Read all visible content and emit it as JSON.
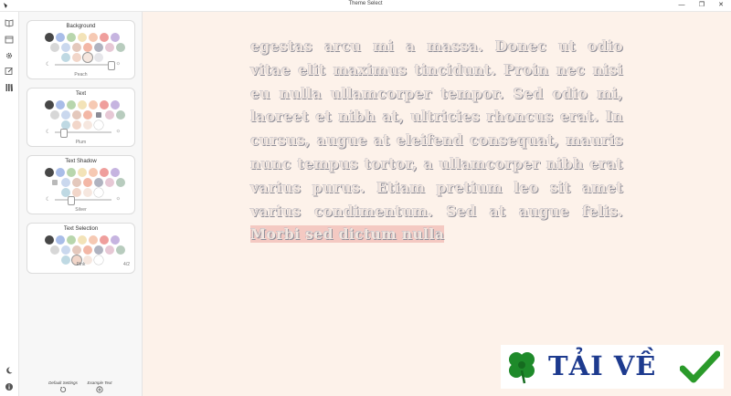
{
  "window": {
    "title": "Theme Select",
    "minimize_glyph": "—",
    "maximize_glyph": "❐",
    "close_glyph": "✕"
  },
  "rail": {
    "icons": [
      "book-icon",
      "calendar-icon",
      "gear-icon",
      "edit-icon",
      "library-icon"
    ],
    "bottom_icons": [
      "moon-icon",
      "info-icon"
    ]
  },
  "panel": {
    "cards": [
      {
        "title": "Background",
        "selected": "Peach",
        "slider_value": 0.85
      },
      {
        "title": "Text",
        "selected": "Plum",
        "slider_value": 0.12
      },
      {
        "title": "Text Shadow",
        "selected": "Silver",
        "slider_value": 0.25
      },
      {
        "title": "Text Selection",
        "selected": "Pink",
        "corner": "4/2"
      }
    ],
    "footer": {
      "default_settings": "Default Settings",
      "example_text": "Example Text"
    }
  },
  "reader": {
    "body": "egestas arcu mi a massa. Donec ut odio vitae elit maximus tincidunt. Proin nec nisi eu nulla ullamcorper tempor. Sed odio mi, laoreet et nibh at, ultricies rhoncus erat. In cursus, augue at eleifend consequat, mauris nunc tempus tortor, a ullamcorper nibh erat varius purus. Etiam pretium leo sit amet varius condimentum. Sed at augue felis.",
    "highlight": "Morbi sed dictum nulla"
  },
  "watermark": {
    "text": "TẢI VỀ"
  },
  "colors": {
    "reader_bg": "#fdf2ea",
    "palette": [
      "#474747",
      "#a9bde8",
      "#b8d6ad",
      "#f3e3b8",
      "#f6c9b3",
      "#ef9e9c",
      "#c6b4e0",
      "#d7d7d7",
      "#cad8ee",
      "#e4c8bc",
      "#f3b7a6",
      "#b0b3c0",
      "#e7c8d5",
      "#b8ccbe",
      "#bfd9e3",
      "#f2d6c9",
      "#f6e7df",
      "#e6e6ea"
    ]
  }
}
